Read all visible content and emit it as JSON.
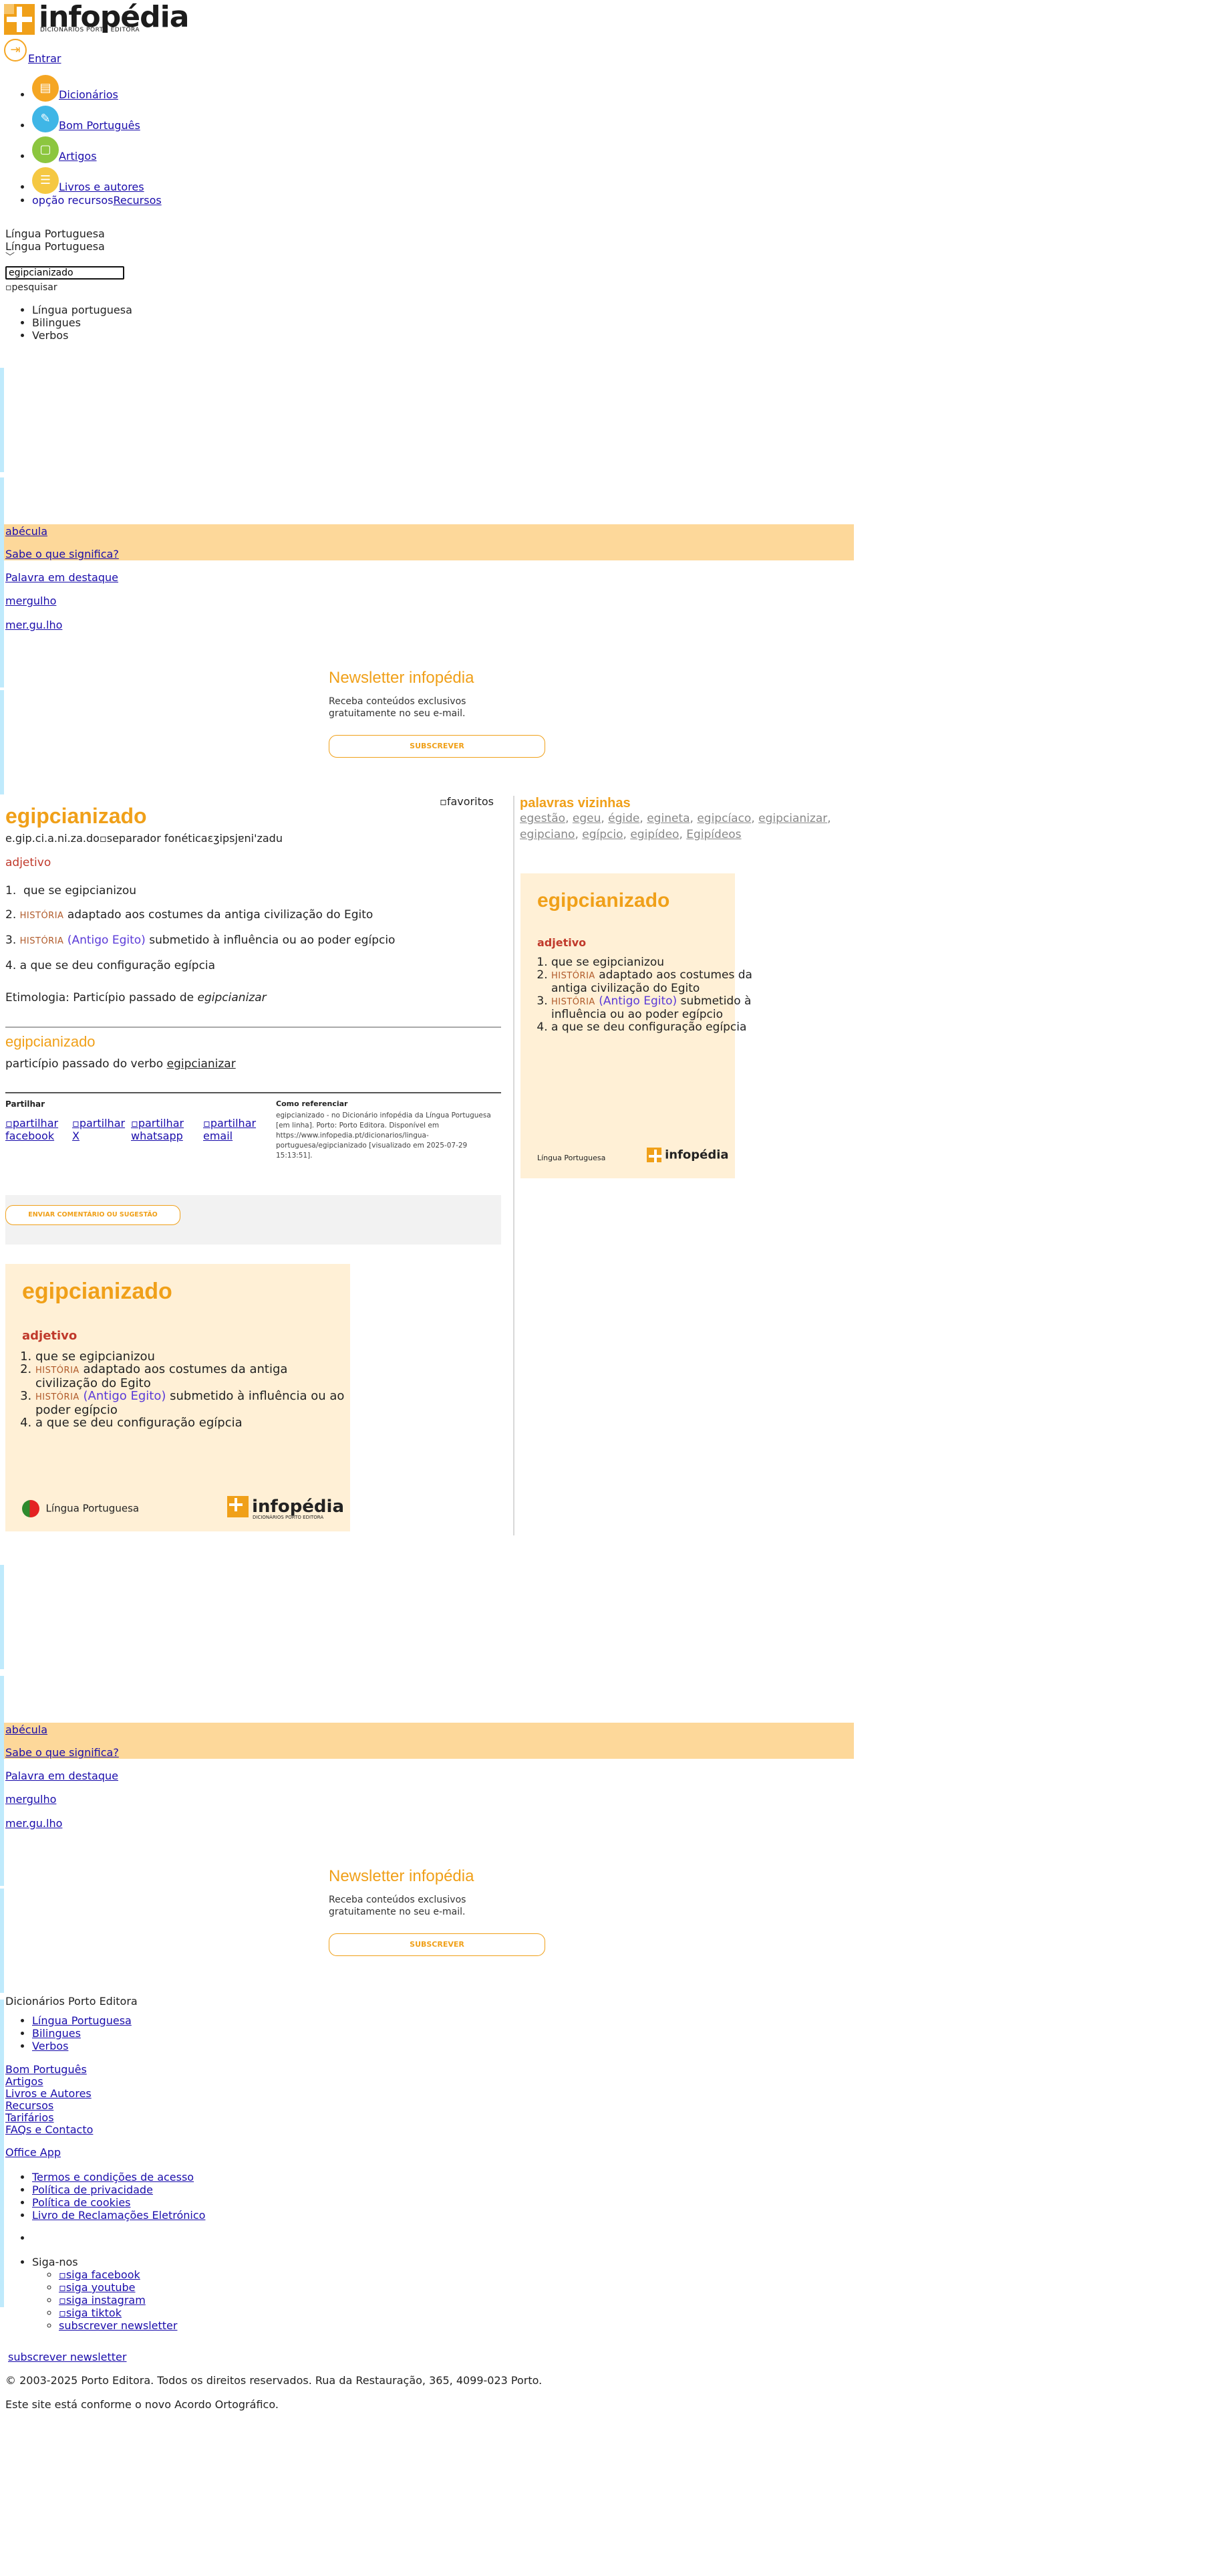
{
  "header": {
    "logo_text": "infopédia",
    "logo_sub": "DICIONÁRIOS PORTO EDITORA",
    "entrar": "Entrar"
  },
  "nav": {
    "items": [
      {
        "label": "Dicionários",
        "color": "#f5a623",
        "icon": "book-icon"
      },
      {
        "label": "Bom Português",
        "color": "#3fb6e6",
        "icon": "pencil-icon"
      },
      {
        "label": "Artigos",
        "color": "#8cc63f",
        "icon": "document-icon"
      },
      {
        "label": "Livros e autores",
        "color": "#f5c842",
        "icon": "books-icon"
      }
    ],
    "recursos_alt": "opção recursos",
    "recursos_label": "Recursos"
  },
  "search": {
    "dictionary_label_1": "Língua Portuguesa",
    "dictionary_label_2": "Língua Portuguesa",
    "value": "egipcianizado",
    "button_alt": "pesquisar",
    "options": [
      "Língua portuguesa",
      "Bilingues",
      "Verbos"
    ]
  },
  "featured_block": {
    "word": "abécula",
    "sabe": "Sabe o que significa?",
    "destaque": "Palavra em destaque",
    "highlight_word": "mergulho",
    "highlight_syll": "mer.gu.lho"
  },
  "newsletter": {
    "title": "Newsletter infopédia",
    "text": "Receba conteúdos exclusivos gratuitamente no seu e-mail.",
    "button": "SUBSCREVER"
  },
  "entry": {
    "favorites_alt": "favoritos",
    "word": "egipcianizado",
    "syllables": "e.gip.ci.a.ni.za.do",
    "separator_alt": "separador fonética",
    "phonetic": "ɛʒipsjɐni'zadu",
    "pos": "adjetivo",
    "senses": [
      {
        "num": "1.",
        "tag": "",
        "region": "",
        "text": "que se egipcianizou"
      },
      {
        "num": "2.",
        "tag": "HISTÓRIA",
        "region": "",
        "text": "adaptado aos costumes da antiga civilização do Egito"
      },
      {
        "num": "3.",
        "tag": "HISTÓRIA",
        "region": "(Antigo Egito)",
        "text": "submetido à influência ou ao poder egípcio"
      },
      {
        "num": "4.",
        "tag": "",
        "region": "",
        "text": "a que se deu configuração egípcia"
      }
    ],
    "etymology_label": "Etimologia: Particípio passado de",
    "etymology_word": "egipcianizar",
    "second_word": "egipcianizado",
    "second_text": "particípio passado do verbo",
    "second_link": "egipcianizar"
  },
  "share": {
    "title": "Partilhar",
    "facebook": "partilhar facebook",
    "x": "partilhar X",
    "whatsapp": "partilhar whatsapp",
    "email": "partilhar email"
  },
  "cite": {
    "title": "Como referenciar",
    "text": "egipcianizado - no Dicionário infopédia da Língua Portuguesa [em linha]. Porto: Porto Editora. Disponível em https://www.infopedia.pt/dicionarios/lingua-portuguesa/egipcianizado [visualizado em 2025-07-29 15:13:51]."
  },
  "feedback_button": "ENVIAR COMENTÁRIO OU SUGESTÃO",
  "neighbors": {
    "title": "palavras vizinhas",
    "words": [
      "egestão",
      "egeu",
      "égide",
      "egineta",
      "egipcíaco",
      "egipcianizar",
      "egipciano",
      "egípcio",
      "egipídeo",
      "Egipídeos"
    ]
  },
  "card": {
    "word": "egipcianizado",
    "pos": "adjetivo",
    "lang": "Língua Portuguesa",
    "logo_text": "infopédia",
    "logo_sub": "DICIONÁRIOS PORTO EDITORA"
  },
  "footer": {
    "group_title": "Dicionários Porto Editora",
    "group_items": [
      "Língua Portuguesa",
      "Bilingues",
      "Verbos"
    ],
    "links": [
      "Bom Português",
      "Artigos",
      "Livros e Autores",
      "Recursos",
      "Tarifários",
      "FAQs e Contacto"
    ],
    "office": "Office App",
    "legal": [
      "Termos e condições de acesso",
      "Política de privacidade",
      "Política de cookies",
      "Livro de Reclamações Eletrónico"
    ],
    "siga": "Siga-nos",
    "social": [
      "siga facebook",
      "siga youtube",
      "siga instagram",
      "siga tiktok"
    ],
    "subscrever": "subscrever newsletter",
    "subscrever2": "subscrever newsletter",
    "copyright": "© 2003-2025 Porto Editora. Todos os direitos reservados. Rua da Restauração, 365, 4099-023 Porto.",
    "acordo": "Este site está conforme o novo Acordo Ortográfico."
  }
}
